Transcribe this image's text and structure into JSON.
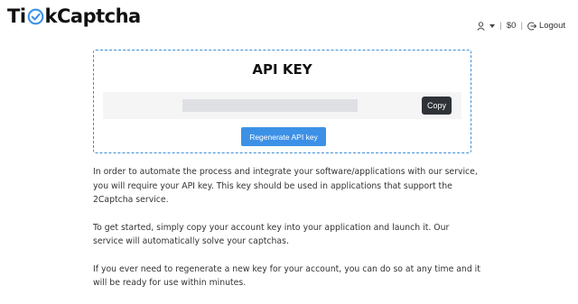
{
  "brand": {
    "name_left": "Ti",
    "name_right": "kCaptcha",
    "check_color": "#3c91e6"
  },
  "topnav": {
    "user_icon": "user-icon",
    "caret_icon": "caret-down-icon",
    "separator": "|",
    "balance": "$0",
    "logout_icon": "logout-icon",
    "logout_label": "Logout"
  },
  "card": {
    "title": "API KEY",
    "api_key_value": "",
    "copy_label": "Copy",
    "regenerate_label": "Regenerate API key",
    "border_color": "#3b8fd8"
  },
  "content": {
    "paragraph1": "In order to automate the process and integrate your software/applications with our service, you will require your API key. This key should be used in applications that support the 2Captcha service.",
    "paragraph2": "To get started, simply copy your account key into your application and launch it. Our service will automatically solve your captchas.",
    "paragraph3": "If you ever need to regenerate a new key for your account, you can do so at any time and it will be ready for use within minutes."
  }
}
